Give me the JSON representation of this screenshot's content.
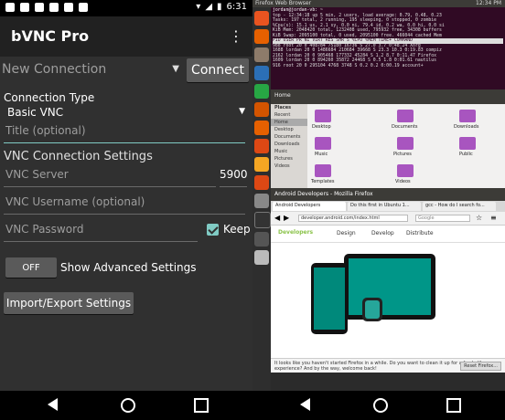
{
  "left_status": {
    "time": "6:31"
  },
  "app": {
    "title": "bVNC Pro",
    "menu_glyph": "⋮"
  },
  "connection": {
    "selector_placeholder": "New Connection",
    "connect_label": "Connect",
    "type_label": "Connection Type",
    "type_value": "Basic VNC",
    "title_placeholder": "Title (optional)"
  },
  "vnc": {
    "section_label": "VNC Connection Settings",
    "server_placeholder": "VNC Server",
    "port_value": "5900",
    "username_placeholder": "VNC Username (optional)",
    "password_placeholder": "VNC Password",
    "keep_label": "Keep"
  },
  "advanced": {
    "toggle_label": "OFF",
    "label": "Show Advanced Settings"
  },
  "import_export_label": "Import/Export Settings",
  "remote": {
    "top_bar_title": "Firefox Web Browser",
    "top_bar_time": "12:34 PM",
    "terminal": {
      "title": "jordan@jordan-vb: ~",
      "lines": [
        "top - 12:34:18 up 5 min,  2 users,  load average: 0.79, 0.48, 0.23",
        "Tasks: 197 total,   2 running, 195 sleeping,   0 stopped,   0 zombie",
        "%Cpu(s): 15.1 us,  2.1 sy,  0.0 ni, 79.4 id,  0.2 wa,  0.0 hi,  0.0 si",
        "KiB Mem:  2048420 total,  1232408 used,   795932 free,   34308 buffers",
        "KiB Swap: 2095100 total,        0 used,  2095100 free.  466044 cached Mem",
        "  PID USER      PR  NI    VIRT    RES    SHR S  %CPU %MEM     TIME+ COMMAND",
        "  988 root      20   0  408784 75180  16736 S  27.0  3.7   0:48.24 Xorg",
        " 1688 lordan    20   0 1486684 210684  39668 S  23.3 10.3   0:19.83 compiz",
        " 2162 lordan    20   0  905468 177332  45284 S   1.2  8.7   0:11.47 Firefox",
        " 1609 lordan    20   0  894260  35872  24468 S   0.5  1.8   0:01.61 nautilus",
        "  916 root      20   0  295104   4768   3748 S   0.2  0.2   0:00.19 account+"
      ]
    },
    "files": {
      "title": "Home",
      "places_label": "Places",
      "places": [
        "Recent",
        "Home",
        "Desktop",
        "Documents",
        "Downloads",
        "Music",
        "Pictures",
        "Videos"
      ],
      "folders": [
        "Desktop",
        "Documents",
        "Downloads",
        "Music",
        "Pictures",
        "Public",
        "Templates",
        "Videos"
      ]
    },
    "firefox": {
      "window_title": "Android Developers - Mozilla Firefox",
      "tabs": [
        "Android Developers",
        "Do this first in Ubuntu 1...",
        "gcc - How do I search fo..."
      ],
      "url": "developer.android.com/index.html",
      "search_placeholder": "Google",
      "site_logo": "Developers",
      "site_nav": [
        "Design",
        "Develop",
        "Distribute"
      ],
      "notice": "It looks like you haven't started Firefox in a while. Do you want to clean it up for a fresh, like-new experience? And by the way, welcome back!",
      "reset_label": "Reset Firefox..."
    }
  },
  "nav_icons": [
    "back-icon",
    "home-icon",
    "recents-icon"
  ]
}
